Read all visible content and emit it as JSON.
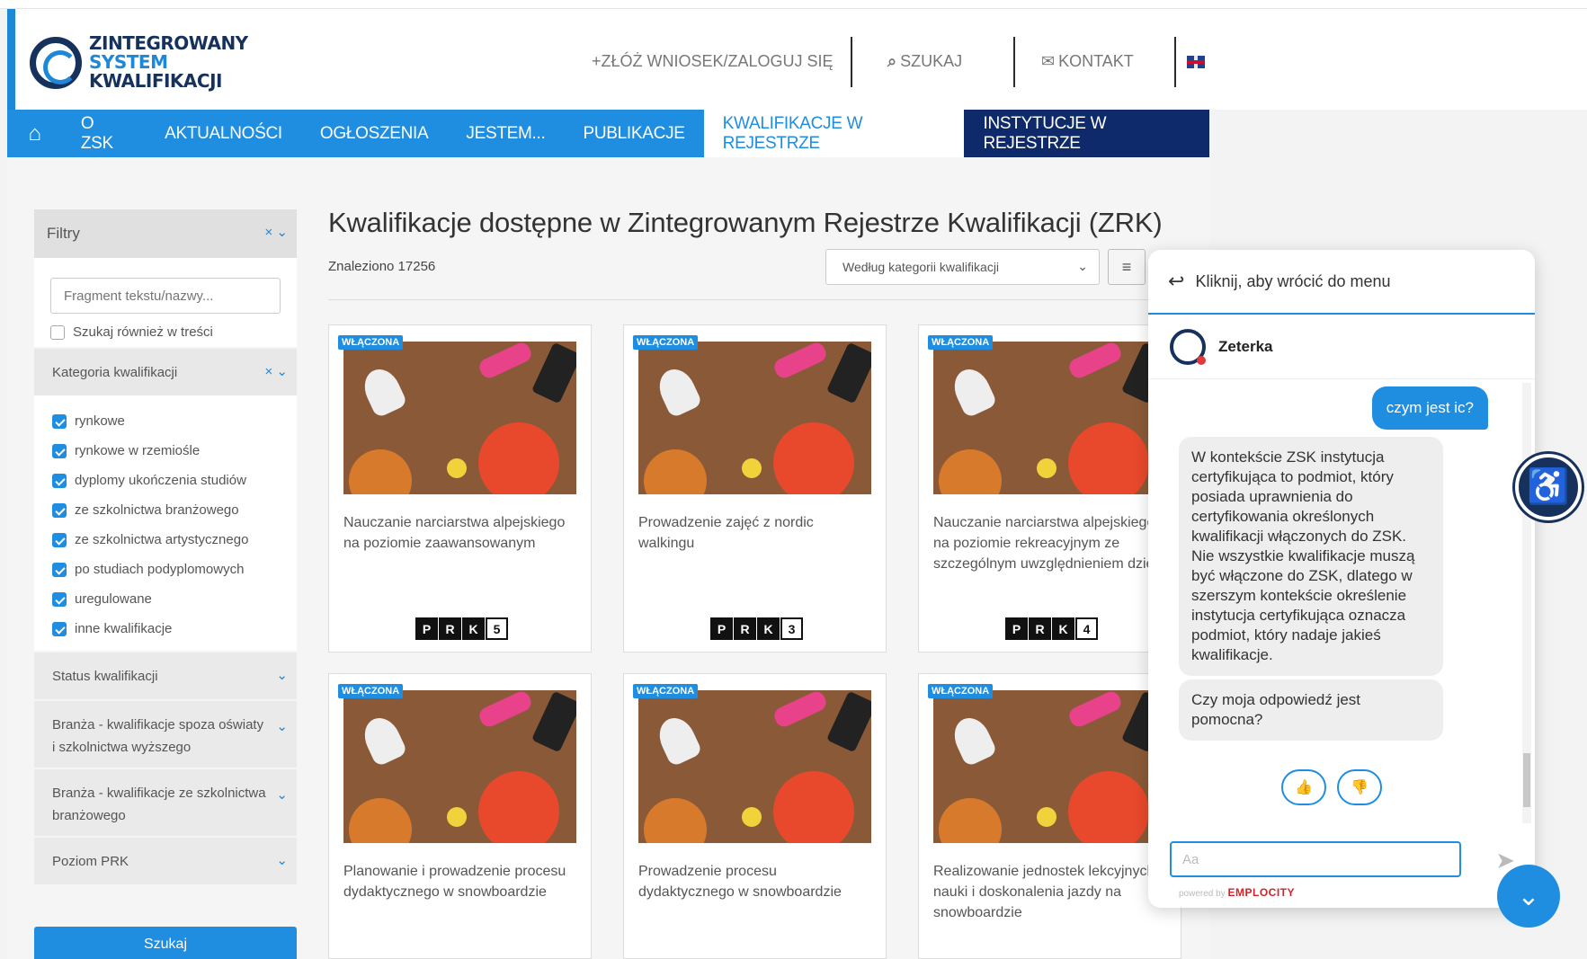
{
  "logo": {
    "line1": "ZINTEGROWANY",
    "line2": "SYSTEM",
    "line3": "KWALIFIKACJI"
  },
  "topnav": {
    "apply": "+ZŁÓŻ WNIOSEK/ZALOGUJ SIĘ",
    "search": "SZUKAJ",
    "contact": "KONTAKT"
  },
  "mainnav": [
    {
      "label": "O ZSK"
    },
    {
      "label": "AKTUALNOŚCI"
    },
    {
      "label": "OGŁOSZENIA"
    },
    {
      "label": "JESTEM..."
    },
    {
      "label": "PUBLIKACJE"
    },
    {
      "label": "KWALIFIKACJE W REJESTRZE"
    },
    {
      "label": "INSTYTUCJE W REJESTRZE"
    }
  ],
  "filters": {
    "title": "Filtry",
    "clear": "× ⌄",
    "search_placeholder": "Fragment tekstu/nazwy...",
    "search_in_content": "Szukaj również w treści",
    "category_title": "Kategoria kwalifikacji",
    "categories": [
      "rynkowe",
      "rynkowe w rzemiośle",
      "dyplomy ukończenia studiów",
      "ze szkolnictwa branżowego",
      "ze szkolnictwa artystycznego",
      "po studiach podyplomowych",
      "uregulowane",
      "inne kwalifikacje"
    ],
    "status": "Status kwalifikacji",
    "branch1": "Branża - kwalifikacje spoza oświaty i szkolnictwa wyższego",
    "branch2": "Branża - kwalifikacje ze szkolnictwa branżowego",
    "prk": "Poziom PRK",
    "button": "Szukaj"
  },
  "main": {
    "title": "Kwalifikacje dostępne w Zintegrowanym Rejestrze Kwalifikacji (ZRK)",
    "found": "Znaleziono 17256",
    "sort": "Według kategorii kwalifikacji"
  },
  "cards": [
    {
      "badge": "WŁĄCZONA",
      "desc": "Nauczanie narciarstwa alpejskiego na poziomie zaawansowanym",
      "level": "5"
    },
    {
      "badge": "WŁĄCZONA",
      "desc": "Prowadzenie zajęć z nordic walkingu",
      "level": "3"
    },
    {
      "badge": "WŁĄCZONA",
      "desc": "Nauczanie narciarstwa alpejskiego na poziomie rekreacyjnym ze szczególnym uwzględnieniem dzieci",
      "level": "4"
    },
    {
      "badge": "WŁĄCZONA",
      "desc": "Planowanie i prowadzenie procesu dydaktycznego w snowboardzie"
    },
    {
      "badge": "WŁĄCZONA",
      "desc": "Prowadzenie procesu dydaktycznego w snowboardzie"
    },
    {
      "badge": "WŁĄCZONA",
      "desc": "Realizowanie jednostek lekcyjnych z nauki i doskonalenia jazdy na snowboardzie"
    }
  ],
  "prk_letters": [
    "P",
    "R",
    "K"
  ],
  "chat": {
    "back": "Kliknij, aby wrócić do menu",
    "agent": "Zeterka",
    "user_msg": "czym jest ic?",
    "bot_msg": "W kontekście ZSK instytucja certyfikująca to podmiot, który posiada uprawnienia do certyfikowania określonych kwalifikacji włączonych do ZSK. Nie wszystkie kwalifikacje muszą być włączone do ZSK, dlatego w szerszym kontekście określenie instytucja certyfikująca oznacza podmiot, który nadaje jakieś kwalifikacje.",
    "bot_q": "Czy moja odpowiedź jest pomocna?",
    "input_placeholder": "Aa",
    "powered": "powered by",
    "brand": "EMPLOCITY"
  },
  "colors": {
    "primary": "#1f8de0",
    "navy": "#0e2a6b",
    "logo_dark": "#16325c"
  }
}
